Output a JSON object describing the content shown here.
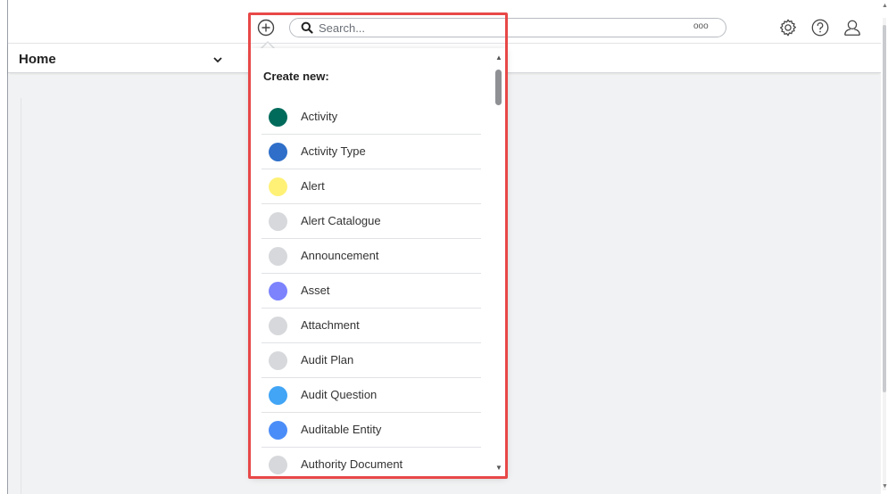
{
  "header": {
    "search": {
      "placeholder": "Search..."
    },
    "more_glyph": "ooo",
    "icons": [
      "plus-circle-icon",
      "search-icon",
      "gear-icon",
      "help-icon",
      "user-icon"
    ]
  },
  "nav": {
    "home_label": "Home"
  },
  "dropdown": {
    "heading": "Create new:",
    "items": [
      {
        "label": "Activity",
        "color": "#006b5b"
      },
      {
        "label": "Activity Type",
        "color": "#2f6fc9"
      },
      {
        "label": "Alert",
        "color": "#fff176"
      },
      {
        "label": "Alert Catalogue",
        "color": "#d6d8db"
      },
      {
        "label": "Announcement",
        "color": "#d6d8db"
      },
      {
        "label": "Asset",
        "color": "#7c83fd"
      },
      {
        "label": "Attachment",
        "color": "#d6d8db"
      },
      {
        "label": "Audit Plan",
        "color": "#d6d8db"
      },
      {
        "label": "Audit Question",
        "color": "#42a5f5"
      },
      {
        "label": "Auditable Entity",
        "color": "#4b8df8"
      },
      {
        "label": "Authority Document",
        "color": "#d6d8db"
      }
    ]
  },
  "colors": {
    "highlight": "#e84848"
  }
}
